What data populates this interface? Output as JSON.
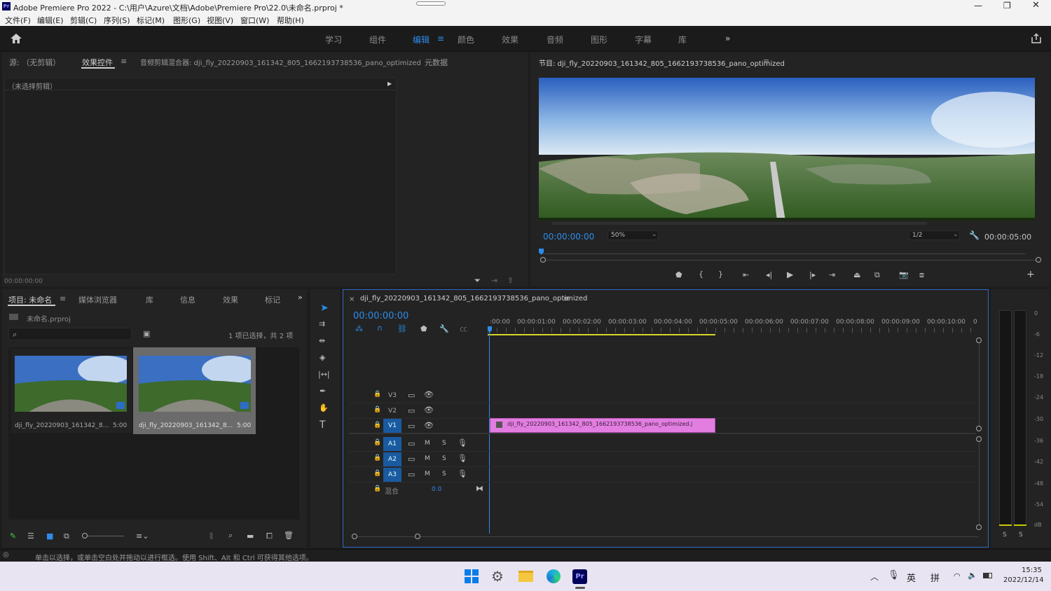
{
  "window": {
    "app_icon": "Pr",
    "title": "Adobe Premiere Pro 2022 - C:\\用户\\Azure\\文档\\Adobe\\Premiere Pro\\22.0\\未命名.prproj *"
  },
  "menu": [
    "文件(F)",
    "编辑(E)",
    "剪辑(C)",
    "序列(S)",
    "标记(M)",
    "图形(G)",
    "视图(V)",
    "窗口(W)",
    "帮助(H)"
  ],
  "workspaces": [
    "学习",
    "组件",
    "编辑",
    "颜色",
    "效果",
    "音频",
    "图形",
    "字幕",
    "库"
  ],
  "source_panel": {
    "tabs": [
      "源: （无剪辑）",
      "效果控件",
      "音频剪辑混合器: dji_fly_20220903_161342_805_1662193738536_pano_optimized",
      "元数据"
    ],
    "no_clip": "（未选择剪辑）",
    "timecode": "00:00:00:00"
  },
  "program_panel": {
    "title": "节目: dji_fly_20220903_161342_805_1662193738536_pano_optimized",
    "timecode": "00:00:00:00",
    "zoom": "50%",
    "resolution": "1/2",
    "duration": "00:00:05:00"
  },
  "project_panel": {
    "tabs": [
      "项目: 未命名",
      "媒体浏览器",
      "库",
      "信息",
      "效果",
      "标记"
    ],
    "file": "未命名.prproj",
    "selection": "1 项已选择，共 2 项",
    "items": [
      {
        "name": "dji_fly_20220903_161342_8...",
        "duration": "5:00"
      },
      {
        "name": "dji_fly_20220903_161342_8...",
        "duration": "5:00"
      }
    ]
  },
  "timeline": {
    "sequence": "dji_fly_20220903_161342_805_1662193738536_pano_optimized",
    "timecode": "00:00:00:00",
    "ruler": [
      ":00:00",
      "00:00:01:00",
      "00:00:02:00",
      "00:00:03:00",
      "00:00:04:00",
      "00:00:05:00",
      "00:00:06:00",
      "00:00:07:00",
      "00:00:08:00",
      "00:00:09:00",
      "00:00:10:00",
      "0"
    ],
    "video_tracks": [
      "V3",
      "V2",
      "V1"
    ],
    "audio_tracks": [
      "A1",
      "A2",
      "A3"
    ],
    "mute": "M",
    "solo": "S",
    "mix_label": "混合",
    "mix_value": "0.0",
    "clip_name": "dji_fly_20220903_161342_805_1662193738536_pano_optimized.j"
  },
  "meter": {
    "labels": [
      "0",
      "-6",
      "-12",
      "-18",
      "-24",
      "-30",
      "-36",
      "-42",
      "-48",
      "-54",
      "dB"
    ],
    "solo": [
      "S",
      "S"
    ]
  },
  "status": "单击以选择，或单击空白处并拖动以进行框选。使用 Shift、Alt 和 Ctrl 可获得其他选项。",
  "taskbar": {
    "lang1": "英",
    "lang2": "拼",
    "time": "15:35",
    "date": "2022/12/14",
    "pr": "Pr"
  }
}
